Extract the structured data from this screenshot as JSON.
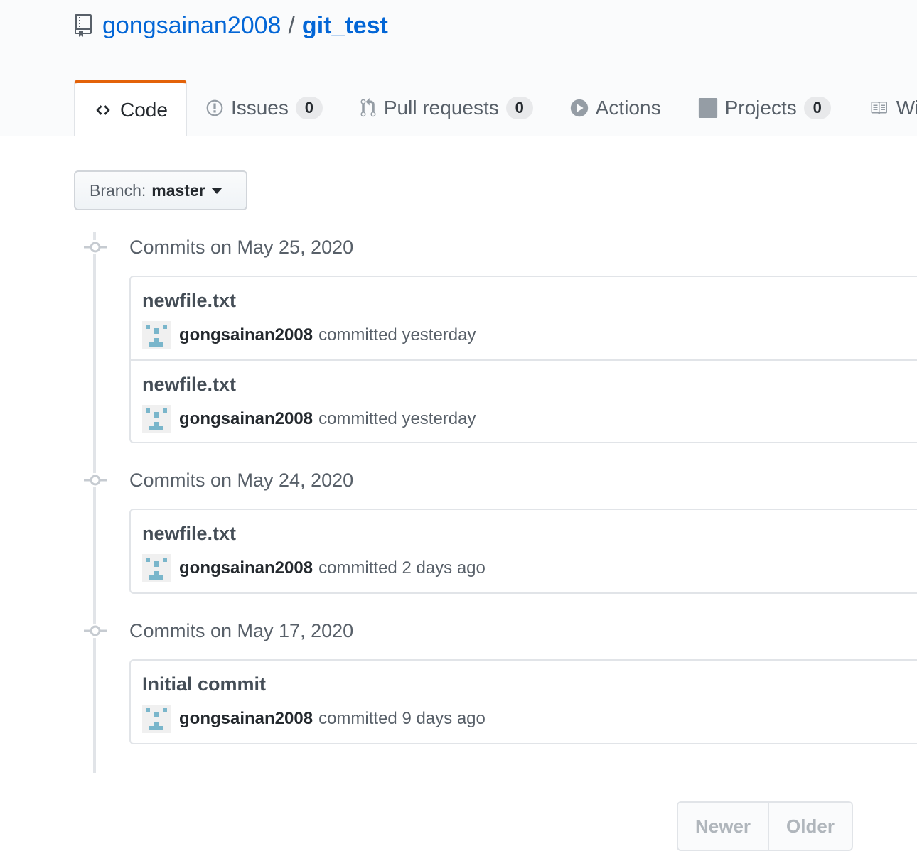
{
  "repo": {
    "owner": "gongsainan2008",
    "separator": "/",
    "name": "git_test"
  },
  "tabs": [
    {
      "label": "Code",
      "icon": "code-icon",
      "selected": true
    },
    {
      "label": "Issues",
      "icon": "issue-icon",
      "count": "0"
    },
    {
      "label": "Pull requests",
      "icon": "pull-request-icon",
      "count": "0"
    },
    {
      "label": "Actions",
      "icon": "play-icon"
    },
    {
      "label": "Projects",
      "icon": "project-icon",
      "count": "0"
    },
    {
      "label": "Wik",
      "icon": "book-icon"
    }
  ],
  "branch": {
    "label": "Branch:",
    "name": "master"
  },
  "groups": [
    {
      "header": "Commits on May 25, 2020",
      "commits": [
        {
          "title": "newfile.txt",
          "author": "gongsainan2008",
          "verb": "committed",
          "when": "yesterday"
        },
        {
          "title": "newfile.txt",
          "author": "gongsainan2008",
          "verb": "committed",
          "when": "yesterday"
        }
      ]
    },
    {
      "header": "Commits on May 24, 2020",
      "commits": [
        {
          "title": "newfile.txt",
          "author": "gongsainan2008",
          "verb": "committed",
          "when": "2 days ago"
        }
      ]
    },
    {
      "header": "Commits on May 17, 2020",
      "commits": [
        {
          "title": "Initial commit",
          "author": "gongsainan2008",
          "verb": "committed",
          "when": "9 days ago"
        }
      ]
    }
  ],
  "pagination": {
    "newer": "Newer",
    "older": "Older"
  },
  "colors": {
    "link": "#0366d6",
    "tab_accent": "#e36209",
    "avatar": "#7ab6cb"
  }
}
